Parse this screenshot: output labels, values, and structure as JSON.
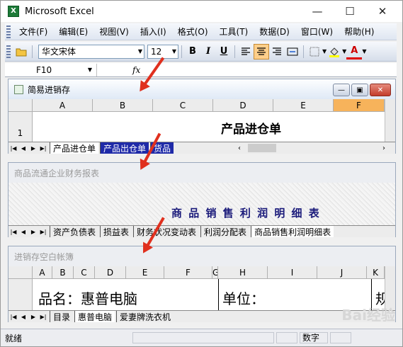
{
  "window": {
    "title": "Microsoft Excel",
    "min": "—",
    "max": "☐",
    "close": "✕"
  },
  "menu": [
    "文件(F)",
    "编辑(E)",
    "视图(V)",
    "插入(I)",
    "格式(O)",
    "工具(T)",
    "数据(D)",
    "窗口(W)",
    "帮助(H)"
  ],
  "toolbar": {
    "font": "华文宋体",
    "size": "12",
    "bold": "B",
    "italic": "I",
    "underline": "U",
    "fontcolor": "A"
  },
  "formula": {
    "namebox": "F10",
    "fx": "fx"
  },
  "win1": {
    "title": "简易进销存",
    "cols": [
      "A",
      "B",
      "C",
      "D",
      "E",
      "F"
    ],
    "row": "1",
    "heading": "产品进仓单",
    "tabs": [
      "产品进仓单",
      "产品出仓单",
      "货品"
    ]
  },
  "win2": {
    "title": "商品流通企业财务报表",
    "heading": "商 品 销 售 利 润 明 细 表",
    "tabs": [
      "资产负债表",
      "损益表",
      "财务状况变动表",
      "利润分配表",
      "商品销售利润明细表"
    ]
  },
  "win3": {
    "title": "进销存空白帐簿",
    "cols": [
      "A",
      "B",
      "C",
      "D",
      "E",
      "F",
      "G",
      "H",
      "I",
      "J",
      "K"
    ],
    "product": "品名：惠普电脑",
    "unit": "单位：",
    "extra": "规",
    "tabs": [
      "目录",
      "惠普电脑",
      "爱妻牌洗衣机"
    ]
  },
  "status": {
    "ready": "就绪",
    "num": "数字"
  },
  "watermark": "Bai经验"
}
